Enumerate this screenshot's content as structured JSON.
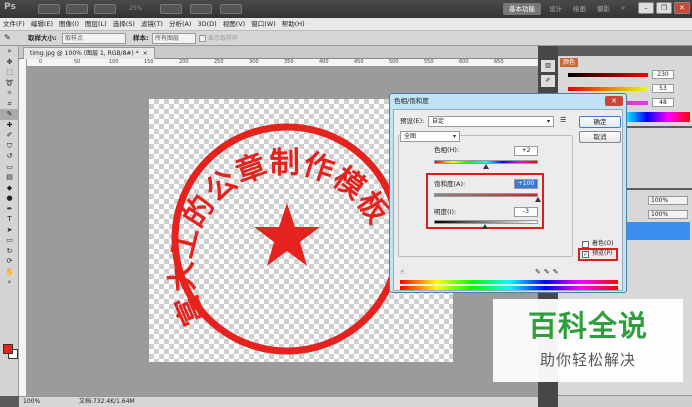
{
  "appbar": {
    "zoom": "25%",
    "workspace_active": "基本功能",
    "workspaces": [
      "设计",
      "绘画",
      "摄影"
    ],
    "more": "»"
  },
  "window_controls": {
    "minimize": "–",
    "restore": "❐",
    "close": "✕"
  },
  "menu": [
    "文件(F)",
    "编辑(E)",
    "图像(I)",
    "图层(L)",
    "选择(S)",
    "滤镜(T)",
    "分析(A)",
    "3D(D)",
    "视图(V)",
    "窗口(W)",
    "帮助(H)"
  ],
  "options": {
    "sample_size_label": "取样大小:",
    "sample_size_value": "取样点",
    "sample_label": "样本:",
    "sample_value": "所有图层",
    "ring_label": "显示取样环"
  },
  "document": {
    "tab_title": "timg.jpg @ 100% (图层 1, RGB/8#) *",
    "ruler_ticks": [
      "0",
      "50",
      "100",
      "150",
      "200",
      "250",
      "300",
      "350",
      "400",
      "450",
      "500",
      "550",
      "600",
      "650"
    ],
    "stamp_text": "富大工的公章制作模板",
    "stamp_color": "#e5221d"
  },
  "status": {
    "zoom": "100%",
    "doc_size": "文档:732.4K/1.64M"
  },
  "right_panels": {
    "color_tab": "颜色",
    "color_values": [
      "230",
      "53",
      "48"
    ],
    "layer_opacity": "100%",
    "layer_fill": "100%"
  },
  "dialog": {
    "title": "色相/饱和度",
    "close": "✕",
    "preset_label": "预设(E):",
    "preset_value": "自定",
    "ok": "确定",
    "cancel": "取消",
    "edit_value": "全图",
    "hue_label": "色相(H):",
    "hue_value": "+2",
    "saturation_label": "饱和度(A):",
    "saturation_value": "+100",
    "lightness_label": "明度(I):",
    "lightness_value": "-3",
    "colorize_label": "着色(O)",
    "preview_label": "预览(P)",
    "preview_checked": "✓",
    "hue_level": 0.5,
    "saturation_level": 1.0,
    "lightness_level": 0.49
  },
  "watermark": {
    "title": "百科全说",
    "subtitle": "助你轻松解决"
  }
}
